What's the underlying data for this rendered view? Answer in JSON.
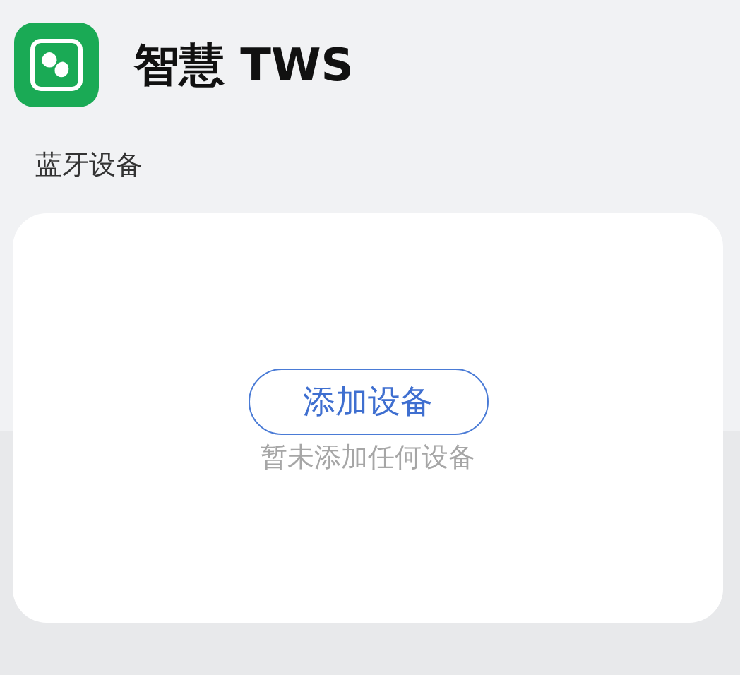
{
  "app": {
    "title": "智慧 TWS"
  },
  "section": {
    "title": "蓝牙设备"
  },
  "devices_card": {
    "add_button": "添加设备",
    "empty_message": "暂未添加任何设备"
  }
}
